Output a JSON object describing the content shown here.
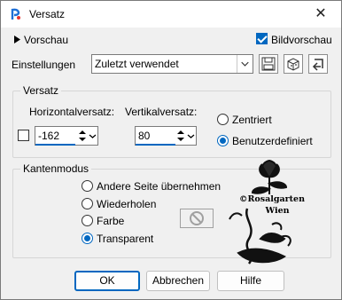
{
  "window": {
    "title": "Versatz",
    "close_glyph": "✕"
  },
  "preview": {
    "label": "Vorschau",
    "bildvorschau_label": "Bildvorschau",
    "bildvorschau_checked": true
  },
  "settings": {
    "label": "Einstellungen",
    "value": "Zuletzt verwendet"
  },
  "toolbar_icons": [
    "save-icon",
    "cube-icon",
    "reset-icon"
  ],
  "offset_group": {
    "title": "Versatz",
    "horizontal_label": "Horizontalversatz:",
    "horizontal_value": "-162",
    "vertical_label": "Vertikalversatz:",
    "vertical_value": "80",
    "options": [
      {
        "label": "Zentriert",
        "selected": false
      },
      {
        "label": "Benutzerdefiniert",
        "selected": true
      }
    ]
  },
  "edge_group": {
    "title": "Kantenmodus",
    "options": [
      {
        "label": "Andere Seite übernehmen",
        "selected": false
      },
      {
        "label": "Wiederholen",
        "selected": false
      },
      {
        "label": "Farbe",
        "selected": false
      },
      {
        "label": "Transparent",
        "selected": true
      }
    ]
  },
  "watermark": {
    "line1": "©Rosalgarten",
    "line2": "Wien"
  },
  "buttons": {
    "ok": "OK",
    "cancel": "Abbrechen",
    "help": "Hilfe"
  },
  "colors": {
    "accent": "#0067c0",
    "background": "#f0f0f0"
  }
}
